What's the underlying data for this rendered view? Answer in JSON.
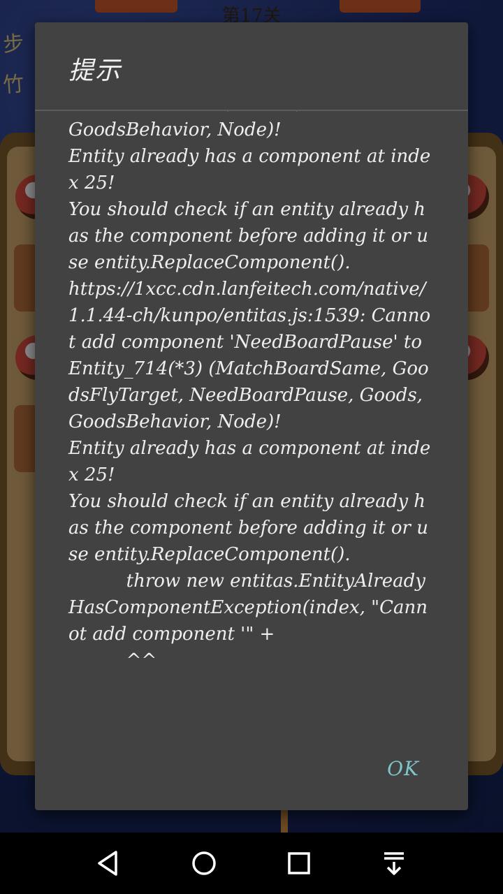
{
  "game": {
    "level_title": "第17关",
    "side_label_1": "步",
    "side_label_2": "竹"
  },
  "dialog": {
    "title": "提示",
    "message": "NeedBoardPause, Goods,\nGoodsBehavior, Node)!\nEntity already has a component at index 25!\nYou should check if an entity already has the component before adding it or use entity.ReplaceComponent().\nhttps://1xcc.cdn.lanfeitech.com/native/1.1.44-ch/kunpo/entitas.js:1539: Cannot add component 'NeedBoardPause' to Entity_714(*3) (MatchBoardSame, GoodsFlyTarget, NeedBoardPause, Goods, GoodsBehavior, Node)!\nEntity already has a component at index 25!\nYou should check if an entity already has the component before adding it or use entity.ReplaceComponent().\n          throw new entitas.EntityAlreadyHasComponentException(index, \"Cannot add component '\" +\n          ^^",
    "ok_label": "OK",
    "ok_color": "#7fc6c8",
    "background_color": "#424242"
  },
  "nav": {
    "back_icon": "back-triangle-icon",
    "home_icon": "home-circle-icon",
    "recents_icon": "recents-square-icon",
    "notify_icon": "notification-shade-icon"
  }
}
